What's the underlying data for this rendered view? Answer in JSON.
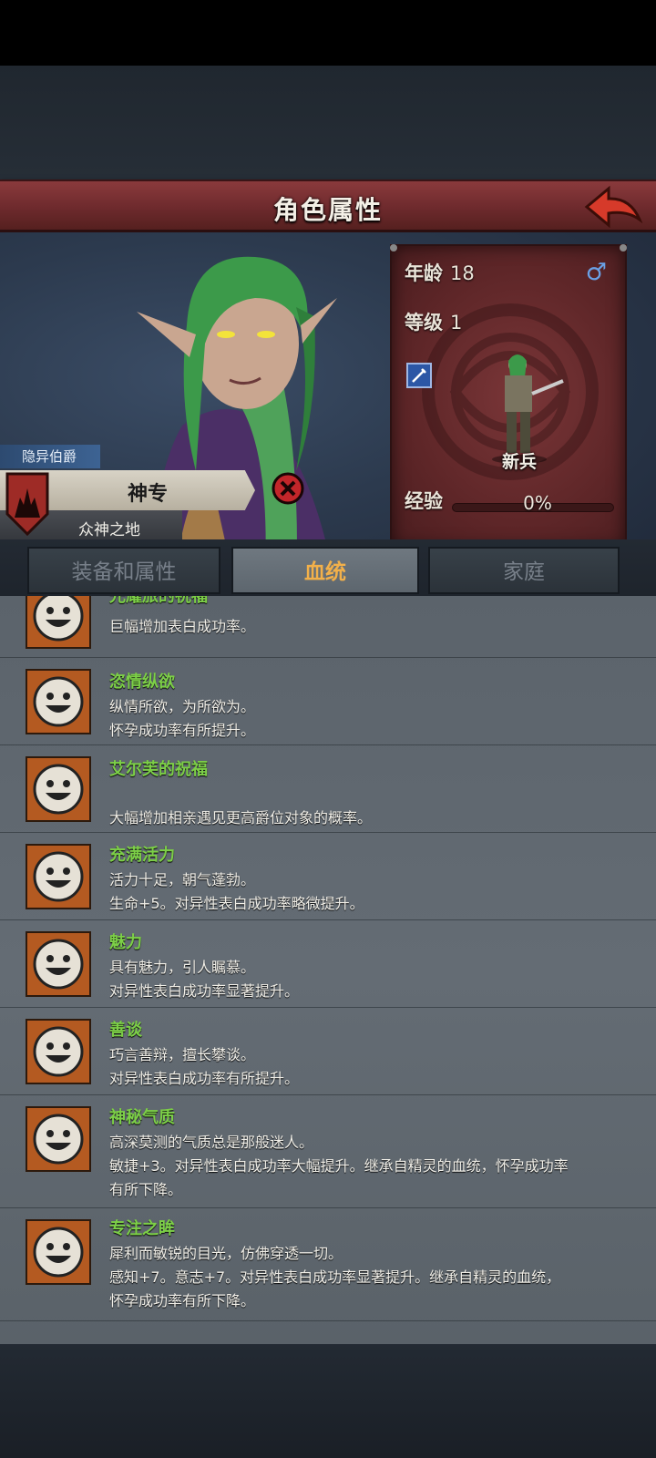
{
  "header": {
    "title": "角色属性"
  },
  "character": {
    "rank": "隐异伯爵",
    "name": "神专",
    "homeland": "众神之地",
    "age_label": "年龄",
    "age": "18",
    "level_label": "等级",
    "level": "1",
    "class_label": "新兵",
    "exp_label": "经验",
    "exp_pct": "0%",
    "exp_progress": 0,
    "gender_icon": "male-icon"
  },
  "tabs": [
    {
      "label": "装备和属性",
      "active": false
    },
    {
      "label": "血统",
      "active": true
    },
    {
      "label": "家庭",
      "active": false
    }
  ],
  "traits": [
    {
      "name": "光耀旅的祝福",
      "lines": [
        "巨幅增加表白成功率。"
      ]
    },
    {
      "name": "恣情纵欲",
      "lines": [
        "纵情所欲，为所欲为。",
        "怀孕成功率有所提升。"
      ]
    },
    {
      "name": "艾尔芙的祝福",
      "lines": [
        "",
        "大幅增加相亲遇见更高爵位对象的概率。"
      ]
    },
    {
      "name": "充满活力",
      "lines": [
        "活力十足，朝气蓬勃。",
        "生命+5。对异性表白成功率略微提升。"
      ]
    },
    {
      "name": "魅力",
      "lines": [
        "具有魅力，引人瞩慕。",
        "对异性表白成功率显著提升。"
      ]
    },
    {
      "name": "善谈",
      "lines": [
        "巧言善辩，擅长攀谈。",
        "对异性表白成功率有所提升。"
      ]
    },
    {
      "name": "神秘气质",
      "lines": [
        "高深莫测的气质总是那般迷人。",
        "敏捷+3。对异性表白成功率大幅提升。继承自精灵的血统，怀孕成功率",
        "有所下降。"
      ]
    },
    {
      "name": "专注之眸",
      "lines": [
        "犀利而敏锐的目光，仿佛穿透一切。",
        "感知+7。意志+7。对异性表白成功率显著提升。继承自精灵的血统，",
        "怀孕成功率有所下降。"
      ]
    }
  ],
  "colors": {
    "trait_name": "#7ccf47",
    "active_tab": "#f2b04a",
    "banner": "#7a3638"
  }
}
